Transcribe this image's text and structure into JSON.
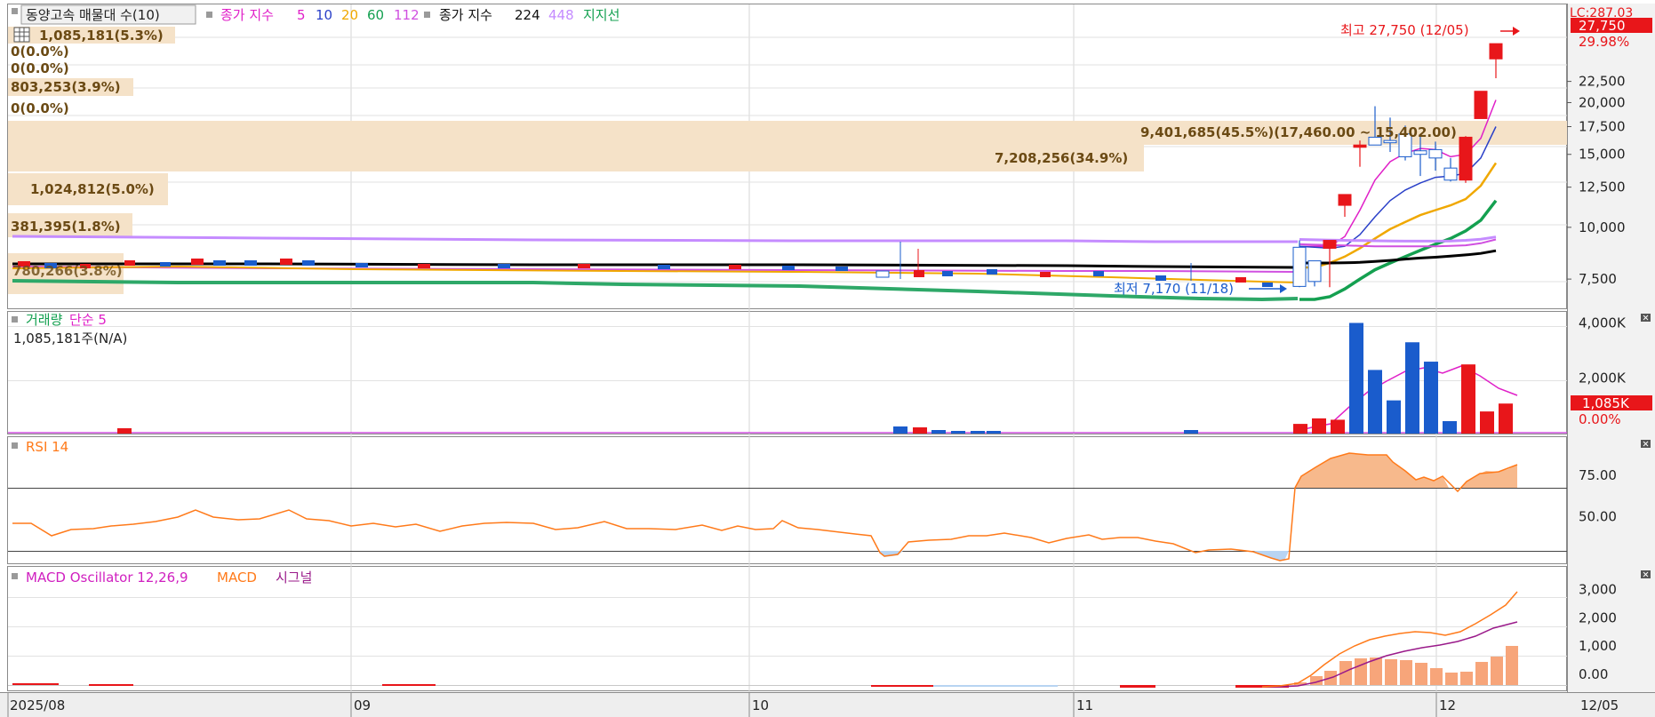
{
  "colors": {
    "up": "#e8161a",
    "down": "#1a5ccc",
    "ma5": "#e020c8",
    "ma10": "#2a40c8",
    "ma20": "#f0a800",
    "ma60": "#14a050",
    "ma112": "#d050e0",
    "ma224": "#000000",
    "ma448": "#c58cff",
    "support": "#2ea868",
    "profile": "#f5e2c8",
    "profile_text": "#6b4a14",
    "rsi": "#ff7a1a",
    "macd": "#ff7a1a",
    "macd_signal": "#9a1a8a",
    "grid": "#d6d6d6",
    "axis_bg": "#eeeeee"
  },
  "header": {
    "title": "동양고속 매물대 수(10)",
    "legend_close_label": "종가 지수",
    "ma_5": "5",
    "ma_10": "10",
    "ma_20": "20",
    "ma_60": "60",
    "ma_112": "112",
    "legend_close_label2": "종가 지수",
    "ma_224": "224",
    "ma_448": "448",
    "support_label": "지지선"
  },
  "price_axis_top": "LC:287.03",
  "price_badges": {
    "last": "27,750",
    "change": "29.98%"
  },
  "annotations": {
    "high": "최고 27,750 (12/05)",
    "low": "최저 7,170 (11/18)"
  },
  "volume_profile": [
    {
      "label": "1,085,181(5.3%)"
    },
    {
      "label": "0(0.0%)"
    },
    {
      "label": "0(0.0%)"
    },
    {
      "label": "803,253(3.9%)"
    },
    {
      "label": "0(0.0%)"
    },
    {
      "label": "9,401,685(45.5%)(17,460.00 ~ 15,402.00)"
    },
    {
      "label": "7,208,256(34.9%)"
    },
    {
      "label": "1,024,812(5.0%)"
    },
    {
      "label": "381,395(1.8%)"
    },
    {
      "label": "780,266(3.8%)"
    }
  ],
  "volume_panel": {
    "title": "거래량",
    "ma_label": "단순 5",
    "current": "1,085,181주(N/A)",
    "badge_value": "1,085K",
    "badge_change": "0.00%"
  },
  "rsi_panel": {
    "title": "RSI 14"
  },
  "macd_panel": {
    "title": "MACD Oscillator 12,26,9",
    "macd_label": "MACD",
    "signal_label": "시그널"
  },
  "x_axis": {
    "ticks": [
      "2025/08",
      "09",
      "10",
      "11",
      "12"
    ],
    "right_label": "12/05"
  },
  "chart_data": {
    "type": "line",
    "price": {
      "scale": "log",
      "ylim": [
        6600,
        30500
      ],
      "ticks": [
        "7,500",
        "10,000",
        "12,500",
        "15,000",
        "17,500",
        "20,000",
        "22,500"
      ],
      "candles": [
        {
          "d": "11/18",
          "o": 8950,
          "h": 9300,
          "l": 7170,
          "c": 7200
        },
        {
          "d": "11/19",
          "o": 8300,
          "h": 8300,
          "l": 7200,
          "c": 7400
        },
        {
          "d": "11/20",
          "o": 8900,
          "h": 9300,
          "l": 7170,
          "c": 9300
        },
        {
          "d": "11/21",
          "o": 11300,
          "h": 12000,
          "l": 10600,
          "c": 12000
        },
        {
          "d": "11/24",
          "o": 15600,
          "h": 16200,
          "l": 14000,
          "c": 15800
        },
        {
          "d": "11/25",
          "o": 16500,
          "h": 19600,
          "l": 15800,
          "c": 15800
        },
        {
          "d": "11/26",
          "o": 16200,
          "h": 18400,
          "l": 15200,
          "c": 16000
        },
        {
          "d": "11/27",
          "o": 16800,
          "h": 17600,
          "l": 14500,
          "c": 14800
        },
        {
          "d": "11/28",
          "o": 15300,
          "h": 16800,
          "l": 13300,
          "c": 15000
        },
        {
          "d": "12/01",
          "o": 15400,
          "h": 16100,
          "l": 13700,
          "c": 14700
        },
        {
          "d": "12/02",
          "o": 13900,
          "h": 14700,
          "l": 12900,
          "c": 13000
        },
        {
          "d": "12/03",
          "o": 13000,
          "h": 16600,
          "l": 12800,
          "c": 16500
        },
        {
          "d": "12/04",
          "o": 18300,
          "h": 21300,
          "l": 18300,
          "c": 21300
        },
        {
          "d": "12/05",
          "o": 25500,
          "h": 27750,
          "l": 22900,
          "c": 27750
        }
      ],
      "moving_averages": {
        "ma5": [
          9000,
          9000,
          9000,
          9500,
          11000,
          13000,
          14400,
          15100,
          15500,
          15400,
          14800,
          15000,
          16400,
          20300
        ],
        "ma10": [
          9000,
          8950,
          8900,
          9000,
          9600,
          10600,
          11600,
          12300,
          12800,
          13200,
          13300,
          13500,
          14700,
          17500
        ],
        "ma20": [
          8000,
          8000,
          8200,
          8500,
          8900,
          9400,
          9900,
          10300,
          10700,
          11000,
          11300,
          11700,
          12600,
          14300
        ],
        "ma60": [
          6700,
          6700,
          6800,
          7100,
          7500,
          7900,
          8200,
          8500,
          8800,
          9100,
          9400,
          9800,
          10400,
          11600
        ],
        "ma112": [
          9100,
          9080,
          9060,
          9040,
          9020,
          9000,
          9000,
          9000,
          9000,
          9000,
          9020,
          9050,
          9150,
          9350
        ],
        "ma224": [
          8200,
          8200,
          8200,
          8210,
          8230,
          8270,
          8320,
          8380,
          8430,
          8470,
          8520,
          8580,
          8650,
          8780
        ],
        "ma448": [
          9350,
          9330,
          9310,
          9300,
          9290,
          9280,
          9270,
          9260,
          9260,
          9260,
          9270,
          9300,
          9360,
          9480
        ]
      }
    },
    "volume": {
      "ylim": [
        0,
        4400000
      ],
      "ticks": [
        "4,000K",
        "2,000K"
      ],
      "values": [
        350000,
        550000,
        500000,
        4000000,
        2300000,
        1200000,
        3300000,
        2600000,
        450000,
        2500000,
        800000,
        1085181
      ]
    },
    "rsi": {
      "ylim": [
        22,
        98
      ],
      "ticks": [
        "75.00",
        "50.00"
      ],
      "levels": [
        70,
        30
      ]
    },
    "macd": {
      "ylim": [
        -600,
        3800
      ],
      "ticks": [
        "3,000",
        "2,000",
        "1,000",
        "0.00"
      ]
    }
  }
}
